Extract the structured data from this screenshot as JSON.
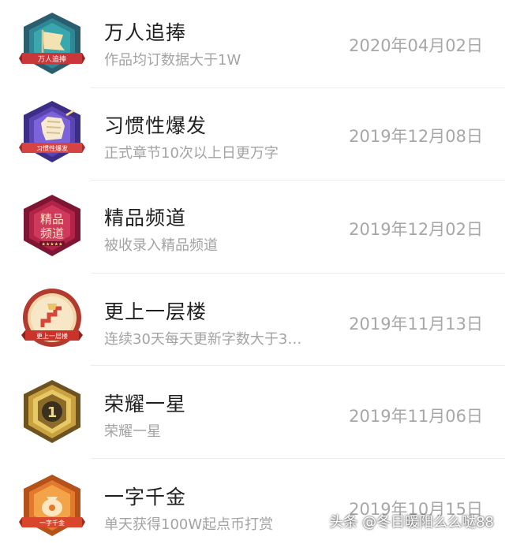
{
  "achievements": [
    {
      "title": "万人追捧",
      "desc": "作品均订数据大于1W",
      "date": "2020年04月02日",
      "badge_text": "万人追捧",
      "icon": "teal-flag-badge-icon"
    },
    {
      "title": "习惯性爆发",
      "desc": "正式章节10次以上日更万字",
      "date": "2019年12月08日",
      "badge_text": "习惯性爆发",
      "icon": "purple-fist-badge-icon"
    },
    {
      "title": "精品频道",
      "desc": "被收录入精品频道",
      "date": "2019年12月02日",
      "badge_text": "精品频道",
      "icon": "crimson-boutique-badge-icon"
    },
    {
      "title": "更上一层楼",
      "desc": "连续30天每天更新字数大于3…",
      "date": "2019年11月13日",
      "badge_text": "更上一层楼",
      "icon": "stairs-badge-icon"
    },
    {
      "title": "荣耀一星",
      "desc": "荣耀一星",
      "date": "2019年11月06日",
      "badge_text": "1",
      "icon": "gold-star-one-badge-icon"
    },
    {
      "title": "一字千金",
      "desc": "单天获得100W起点币打赏",
      "date": "2019年10月15日",
      "badge_text": "一字千金",
      "icon": "orange-money-bag-badge-icon"
    }
  ],
  "watermark": "头条 @冬日暖阳么么哒88",
  "colors": {
    "title": "#1f1f1f",
    "desc": "#a3a3a3",
    "date": "#a7a7a7",
    "divider": "#ececec"
  }
}
